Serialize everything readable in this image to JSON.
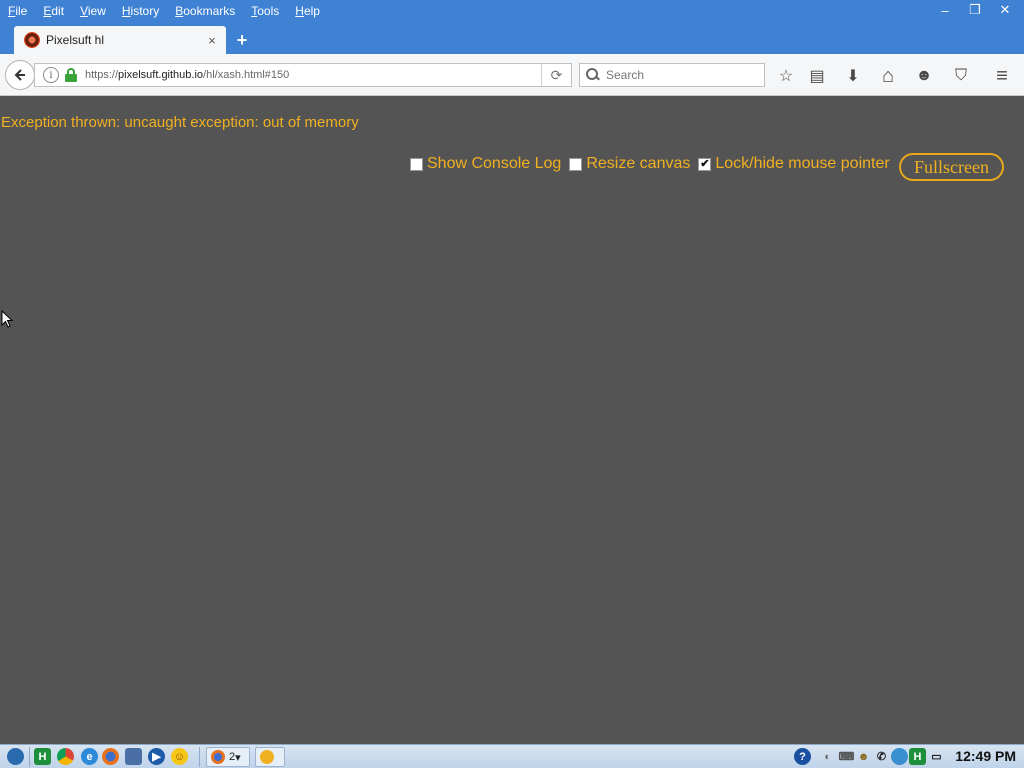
{
  "menubar": {
    "items": [
      {
        "label": "File",
        "key": "F",
        "rest": "ile"
      },
      {
        "label": "Edit",
        "key": "E",
        "rest": "dit"
      },
      {
        "label": "View",
        "key": "V",
        "rest": "iew"
      },
      {
        "label": "History",
        "key": "H",
        "rest": "istory"
      },
      {
        "label": "Bookmarks",
        "key": "B",
        "rest": "ookmarks"
      },
      {
        "label": "Tools",
        "key": "T",
        "rest": "ools"
      },
      {
        "label": "Help",
        "key": "H",
        "rest": "elp"
      }
    ]
  },
  "window_controls": {
    "minimize": "‒",
    "restore": "❐",
    "close": "✕"
  },
  "tab": {
    "title": "Pixelsuft hl",
    "close": "×",
    "new_tab": "+"
  },
  "urlbar": {
    "prefix": "https://",
    "host": "pixelsuft.github.io",
    "path": "/hl/xash.html#150"
  },
  "search": {
    "placeholder": "Search"
  },
  "toolbar": {
    "bookmark_star": "☆",
    "reading_list": "▤",
    "downloads": "⬇",
    "home": "⌂",
    "sync": "☻",
    "pocket": "⛉",
    "menu": "≡"
  },
  "page": {
    "error": "Exception thrown: uncaught exception: out of memory",
    "options": [
      {
        "label": "Show Console Log",
        "checked": false
      },
      {
        "label": "Resize canvas",
        "checked": false
      },
      {
        "label": "Lock/hide mouse pointer",
        "checked": true
      }
    ],
    "fullscreen_label": "Fullscreen"
  },
  "taskbar": {
    "task_count": "2",
    "clock": "12:49 PM"
  },
  "colors": {
    "accent_text": "#f0b020",
    "page_bg": "#545454",
    "chrome_blue": "#3f82d4"
  }
}
